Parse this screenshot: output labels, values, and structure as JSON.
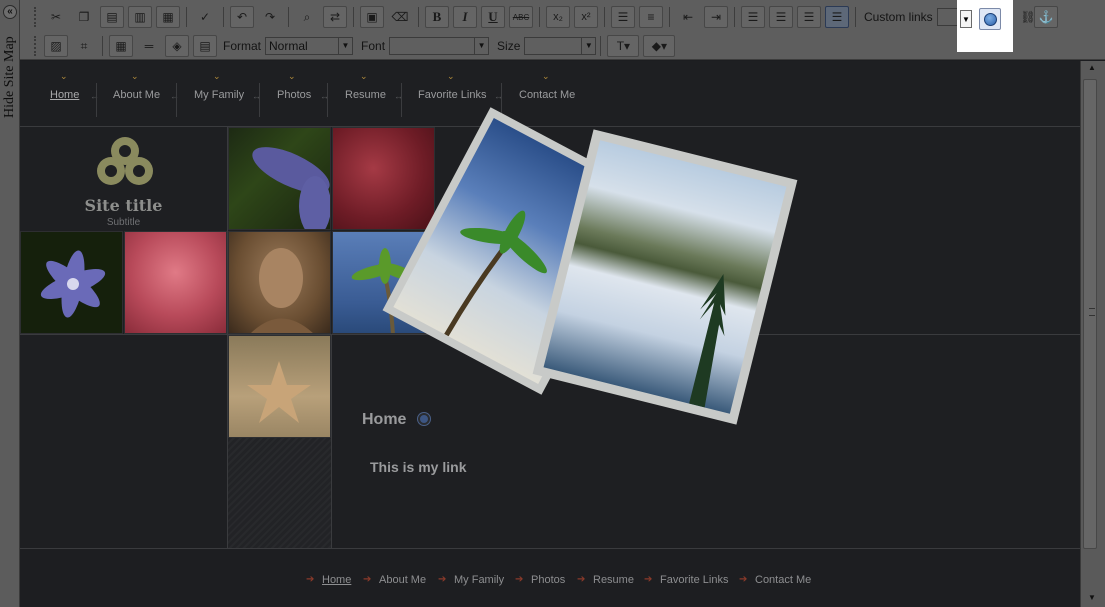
{
  "sidebar": {
    "toggle_glyph": "«",
    "label": "Hide Site Map"
  },
  "toolbar": {
    "custom_links_label": "Custom links",
    "custom_links_value": "",
    "format_label": "Format",
    "format_value": "Normal",
    "font_label": "Font",
    "font_value": "",
    "size_label": "Size",
    "size_value": "",
    "bold": "B",
    "italic": "I",
    "underline": "U",
    "strike": "ABC",
    "subscript": "x₂",
    "superscript": "x²"
  },
  "nav": {
    "items": [
      "Home",
      "About Me",
      "My Family",
      "Photos",
      "Resume",
      "Favorite Links",
      "Contact Me"
    ]
  },
  "site": {
    "title": "Site title",
    "subtitle": "Subtitle"
  },
  "content": {
    "heading": "Home",
    "link_text": "This is my link"
  },
  "footer": {
    "items": [
      "Home",
      "About Me",
      "My Family",
      "Photos",
      "Resume",
      "Favorite Links",
      "Contact Me"
    ]
  },
  "colors": {
    "page_bg": "#1e1f22",
    "toolbar_bg": "#5e5e5e",
    "accent_caret": "#b08a3a",
    "footer_arrow": "#8a3a2a"
  }
}
